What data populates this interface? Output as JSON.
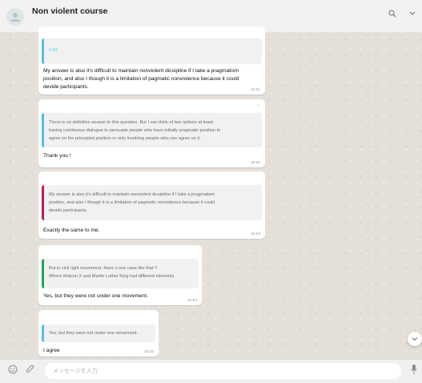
{
  "header": {
    "title": "Non violent course",
    "icons": [
      "avatar-placeholder",
      "search-icon",
      "chevron-down-icon"
    ]
  },
  "messages": [
    {
      "quote_label": "1:42",
      "text_lines": [
        "My answer is also it's difficult to maintain nonviolent dicsipline if I take a pragmatism",
        "position, and also I though it is a limitation of pagmatic nonviolence because it could",
        "devide participants."
      ],
      "time": "16:51"
    },
    {
      "quote_lines": [
        "There is no definitive answer to this question. But I can think of two options at least:",
        "having continuous dialogue to persuade people who have initially pragmatic position to",
        "agree on the principled position or only involving people who can agree on it."
      ],
      "text": "Thank you !",
      "time": "16:52"
    },
    {
      "quote_lines": [
        "My answer is also it's difficult to maintain nonviolent dicsipline if I take a pragmatism",
        "position, and also I though it is a limitation of pagmatic nonviolence because it could",
        "devide participants."
      ],
      "text": "Exactly the same to me.",
      "time": "16:53"
    },
    {
      "quote_lines": [
        "But in civil right movement, there s one case like that !!",
        "Where Malcon X and Martin Luther King had different elements"
      ],
      "text": "Yes, but they were not under one movement.",
      "time": "16:53"
    },
    {
      "quote_lines": [
        "Yes, but they were not under one movement."
      ],
      "text": "I agree",
      "time": "16:53"
    }
  ],
  "footer": {
    "placeholder": "メッセージを入力",
    "icons": [
      "emoji-icon",
      "attach-icon",
      "mic-icon"
    ]
  },
  "colors": {
    "quote_bar_blue": "#53bdeb",
    "quote_bar_magenta": "#c2185b",
    "quote_bar_green": "#25a466"
  }
}
